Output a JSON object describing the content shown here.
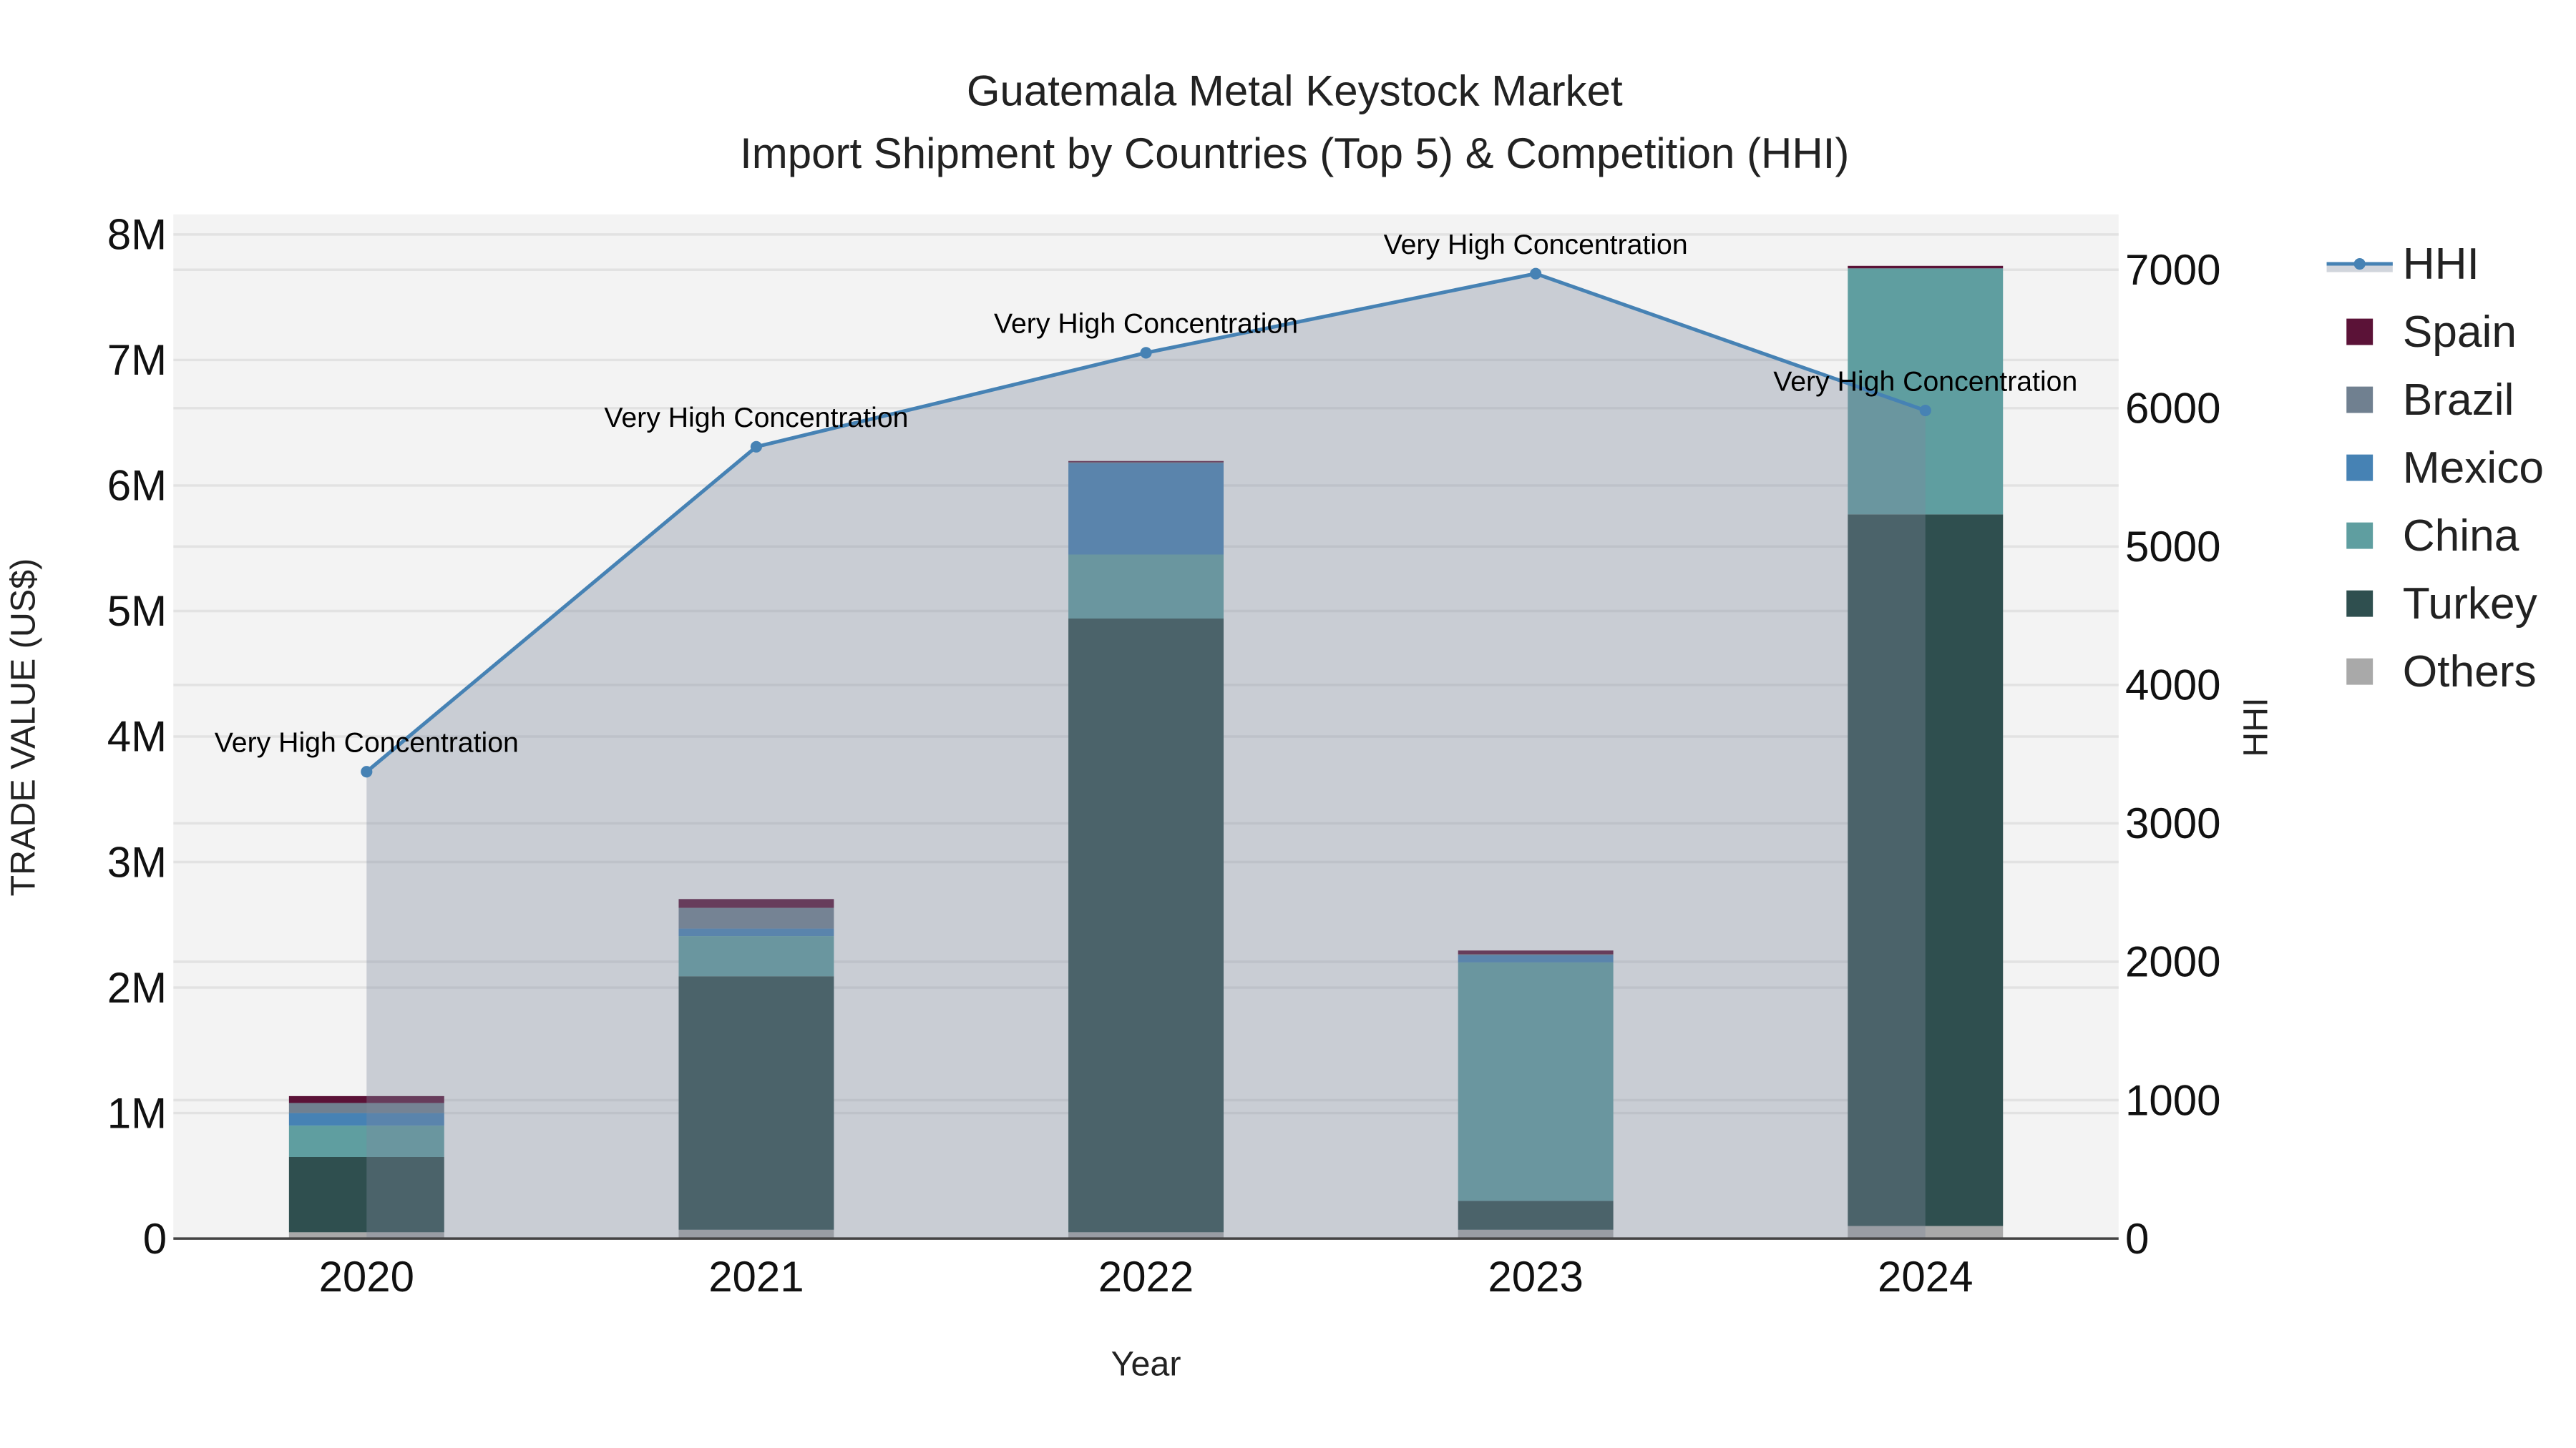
{
  "chart_data": {
    "type": "bar",
    "stacked": true,
    "title": "Guatemala Metal Keystock Market",
    "subtitle": "Import Shipment by Countries (Top 5) & Competition (HHI)",
    "xlabel": "Year",
    "ylabel": "TRADE VALUE (US$)",
    "y2label": "HHI",
    "categories": [
      "2020",
      "2021",
      "2022",
      "2023",
      "2024"
    ],
    "ylim": [
      0,
      8160000
    ],
    "y2lim": [
      0,
      7400
    ],
    "yticks": [
      0,
      1000000,
      2000000,
      3000000,
      4000000,
      5000000,
      6000000,
      7000000,
      8000000
    ],
    "ytick_labels": [
      "0",
      "1M",
      "2M",
      "3M",
      "4M",
      "5M",
      "6M",
      "7M",
      "8M"
    ],
    "y2ticks": [
      0,
      1000,
      2000,
      3000,
      4000,
      5000,
      6000,
      7000
    ],
    "y2tick_labels": [
      "0",
      "1000",
      "2000",
      "3000",
      "4000",
      "5000",
      "6000",
      "7000"
    ],
    "grid": true,
    "legend_position": "right",
    "series": [
      {
        "name": "Others",
        "color": "#a9a9a9",
        "values": [
          50000,
          70000,
          50000,
          70000,
          100000
        ]
      },
      {
        "name": "Turkey",
        "color": "#2f4f4f",
        "values": [
          600000,
          2020000,
          4890000,
          230000,
          5670000
        ]
      },
      {
        "name": "China",
        "color": "#5f9ea0",
        "values": [
          250000,
          320000,
          510000,
          1900000,
          1960000
        ]
      },
      {
        "name": "Mexico",
        "color": "#4682b4",
        "values": [
          100000,
          60000,
          730000,
          60000,
          0
        ]
      },
      {
        "name": "Brazil",
        "color": "#708090",
        "values": [
          80000,
          165000,
          5000,
          5000,
          0
        ]
      },
      {
        "name": "Spain",
        "color": "#5b1237",
        "values": [
          55000,
          70000,
          10000,
          30000,
          20000
        ]
      }
    ],
    "hhi": {
      "name": "HHI",
      "color": "#4682b4",
      "values": [
        3373,
        5721,
        6400,
        6972,
        5983
      ],
      "annotations": [
        "Very High Concentration",
        "Very High Concentration",
        "Very High Concentration",
        "Very High Concentration",
        "Very High Concentration"
      ]
    },
    "legend_order": [
      "HHI",
      "Spain",
      "Brazil",
      "Mexico",
      "China",
      "Turkey",
      "Others"
    ]
  }
}
